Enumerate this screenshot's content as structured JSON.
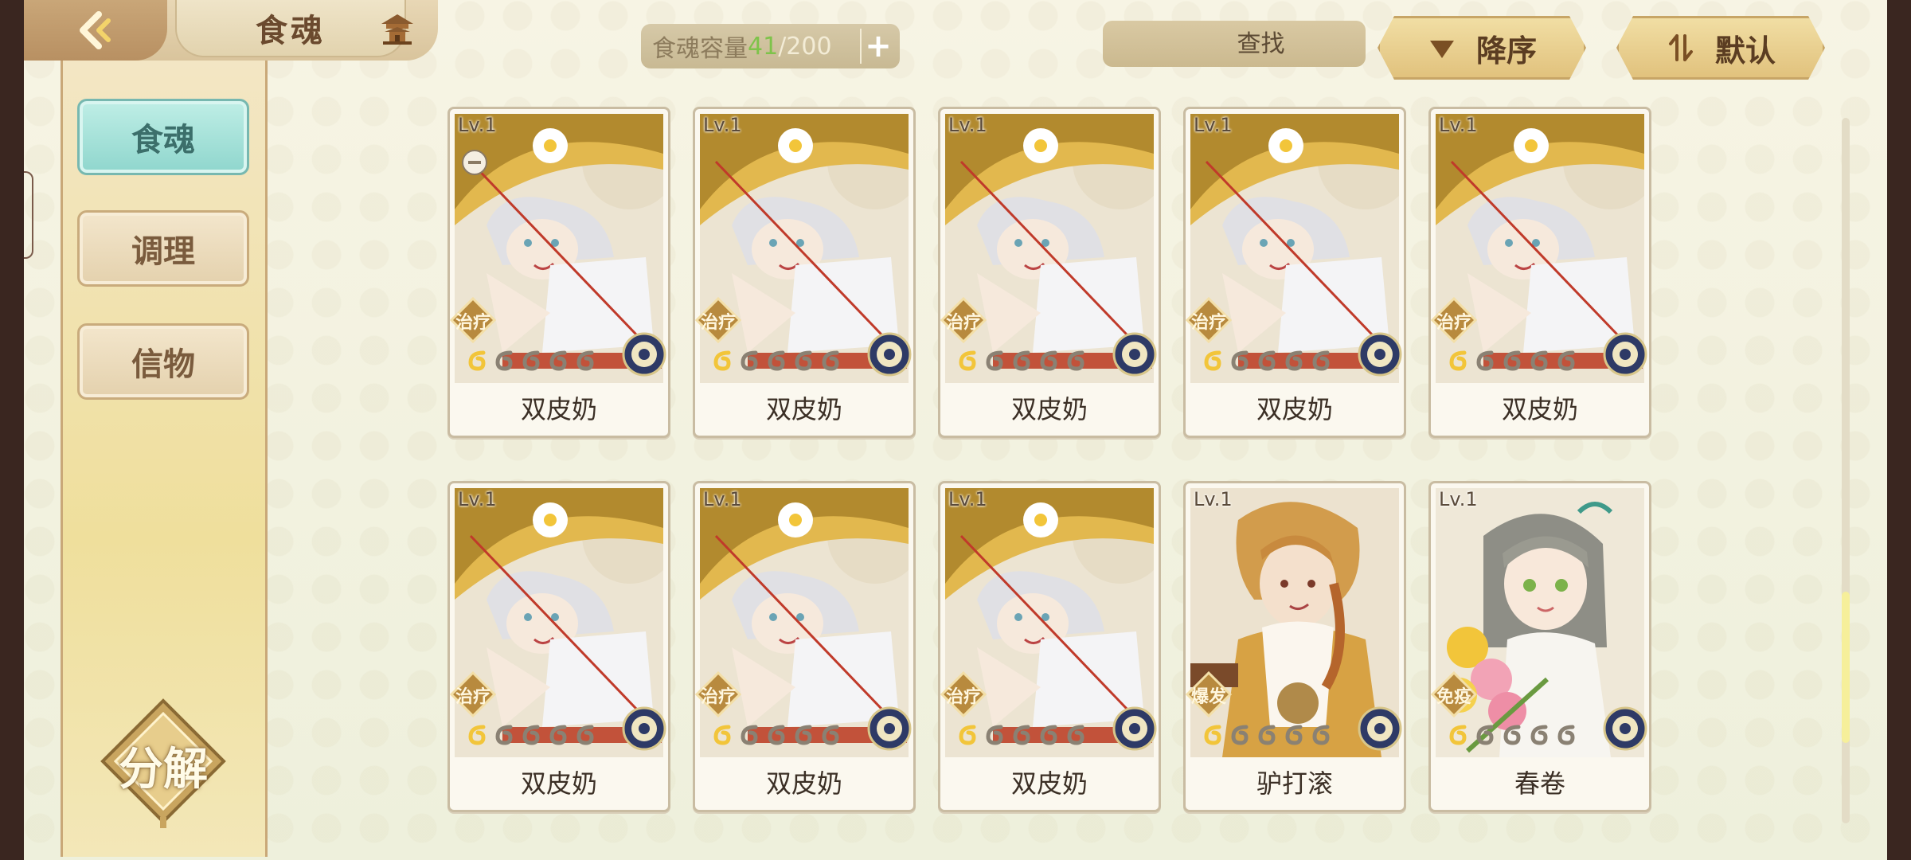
{
  "header": {
    "title": "食魂",
    "capacity": {
      "label": "食魂容量",
      "current": "41",
      "separator": "/",
      "max": "200",
      "plus": "+"
    },
    "search": {
      "placeholder": "查找"
    },
    "sort_order_label": "降序",
    "sort_mode_label": "默认"
  },
  "sidebar": {
    "items": [
      {
        "label": "食魂",
        "active": true
      },
      {
        "label": "调理",
        "active": false
      },
      {
        "label": "信物",
        "active": false
      }
    ],
    "decompose_label": "分解"
  },
  "cards": [
    {
      "level": "Lv.1",
      "role": "治疗",
      "name": "双皮奶",
      "stars": 1,
      "art": "shuangpinai",
      "locked": true
    },
    {
      "level": "Lv.1",
      "role": "治疗",
      "name": "双皮奶",
      "stars": 1,
      "art": "shuangpinai",
      "locked": false
    },
    {
      "level": "Lv.1",
      "role": "治疗",
      "name": "双皮奶",
      "stars": 1,
      "art": "shuangpinai",
      "locked": false
    },
    {
      "level": "Lv.1",
      "role": "治疗",
      "name": "双皮奶",
      "stars": 1,
      "art": "shuangpinai",
      "locked": false
    },
    {
      "level": "Lv.1",
      "role": "治疗",
      "name": "双皮奶",
      "stars": 1,
      "art": "shuangpinai",
      "locked": false
    },
    {
      "level": "Lv.1",
      "role": "治疗",
      "name": "双皮奶",
      "stars": 1,
      "art": "shuangpinai",
      "locked": false
    },
    {
      "level": "Lv.1",
      "role": "治疗",
      "name": "双皮奶",
      "stars": 1,
      "art": "shuangpinai",
      "locked": false
    },
    {
      "level": "Lv.1",
      "role": "治疗",
      "name": "双皮奶",
      "stars": 1,
      "art": "shuangpinai",
      "locked": false
    },
    {
      "level": "Lv.1",
      "role": "爆发",
      "name": "驴打滚",
      "stars": 1,
      "art": "lvdagun",
      "locked": false
    },
    {
      "level": "Lv.1",
      "role": "免疫",
      "name": "春卷",
      "stars": 1,
      "art": "chunjuan",
      "locked": false
    }
  ],
  "colors": {
    "accent_teal": "#8fd6cd",
    "gold": "#e1c27d",
    "star_filled": "#f2c53a",
    "star_empty": "#8a8173",
    "capacity_current": "#7ec34a"
  },
  "icons": [
    "back-arrow-icon",
    "pagoda-icon",
    "search-icon",
    "close-icon",
    "triangle-down-icon",
    "sort-swap-icon",
    "element-wheel-icon",
    "star-icon"
  ]
}
